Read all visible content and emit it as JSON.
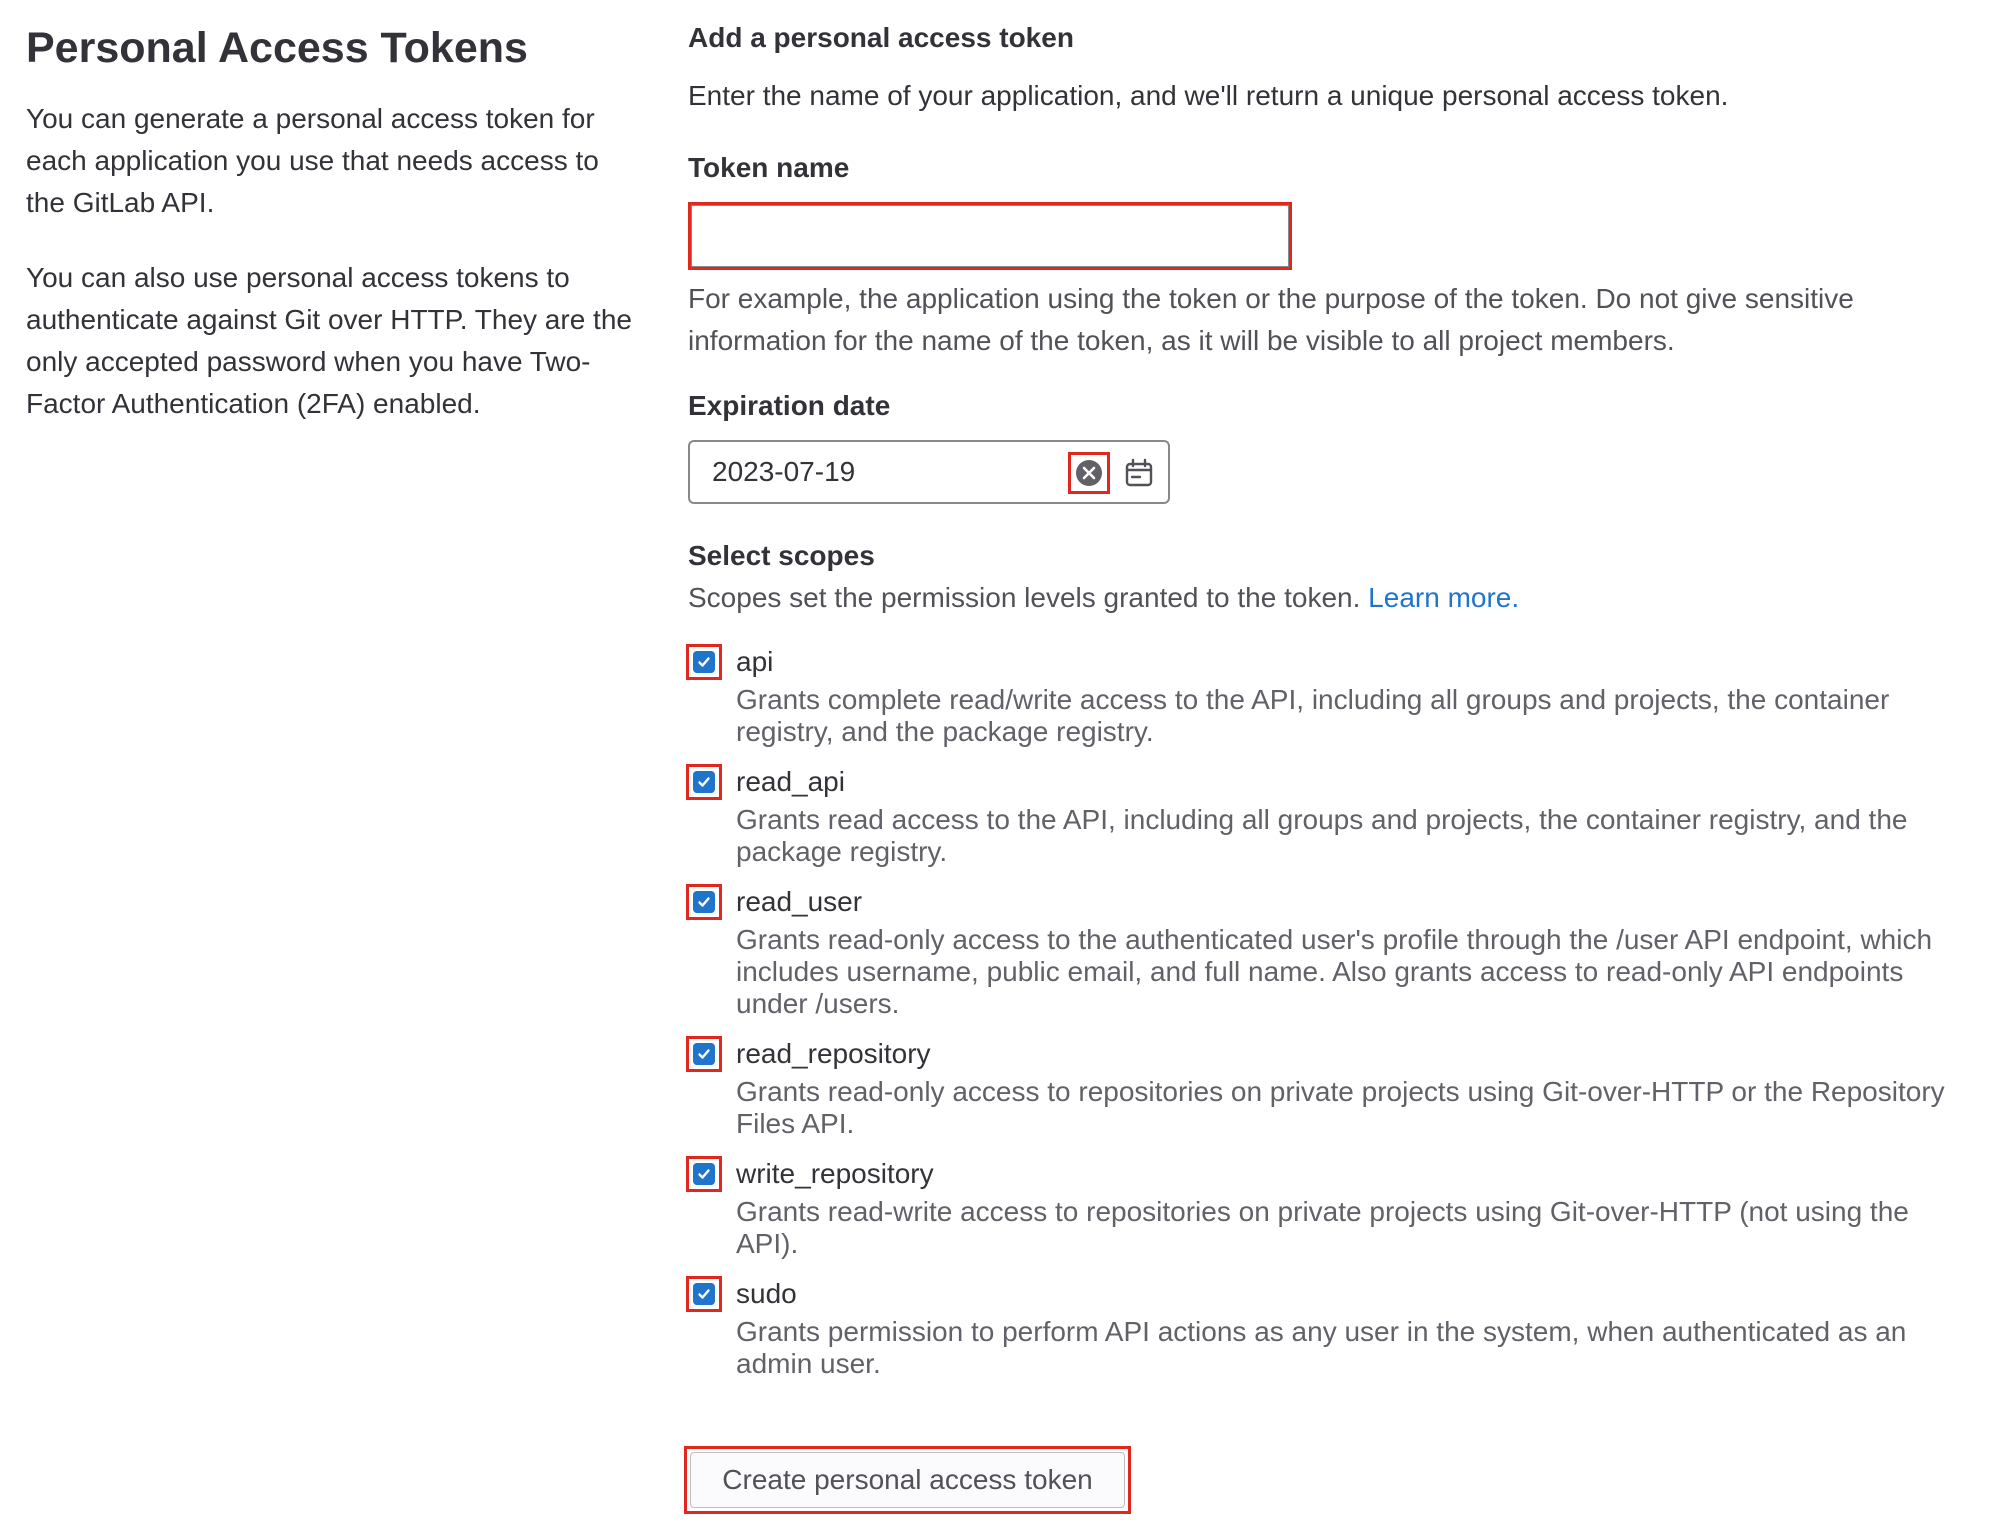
{
  "left": {
    "title": "Personal Access Tokens",
    "paragraphs": [
      "You can generate a personal access token for each application you use that needs access to the GitLab API.",
      "You can also use personal access tokens to authenticate against Git over HTTP. They are the only accepted password when you have Two-Factor Authentication (2FA) enabled."
    ]
  },
  "form": {
    "heading": "Add a personal access token",
    "description": "Enter the name of your application, and we'll return a unique personal access token.",
    "token_name": {
      "label": "Token name",
      "value": "",
      "help": "For example, the application using the token or the purpose of the token. Do not give sensitive information for the name of the token, as it will be visible to all project members."
    },
    "expiration": {
      "label": "Expiration date",
      "value": "2023-07-19"
    },
    "scopes": {
      "label": "Select scopes",
      "description": "Scopes set the permission levels granted to the token.",
      "learn_more": "Learn more.",
      "items": [
        {
          "name": "api",
          "checked": true,
          "description": "Grants complete read/write access to the API, including all groups and projects, the container registry, and the package registry."
        },
        {
          "name": "read_api",
          "checked": true,
          "description": "Grants read access to the API, including all groups and projects, the container registry, and the package registry."
        },
        {
          "name": "read_user",
          "checked": true,
          "description": "Grants read-only access to the authenticated user's profile through the /user API endpoint, which includes username, public email, and full name. Also grants access to read-only API endpoints under /users."
        },
        {
          "name": "read_repository",
          "checked": true,
          "description": "Grants read-only access to repositories on private projects using Git-over-HTTP or the Repository Files API."
        },
        {
          "name": "write_repository",
          "checked": true,
          "description": "Grants read-write access to repositories on private projects using Git-over-HTTP (not using the API)."
        },
        {
          "name": "sudo",
          "checked": true,
          "description": "Grants permission to perform API actions as any user in the system, when authenticated as an admin user."
        }
      ]
    },
    "submit_label": "Create personal access token"
  },
  "colors": {
    "accent": "#1f75cb",
    "highlight": "#e0291c",
    "text": "#333238",
    "muted": "#626168"
  },
  "icons": {
    "clear": "clear-icon",
    "calendar": "calendar-icon",
    "check": "check-icon"
  }
}
